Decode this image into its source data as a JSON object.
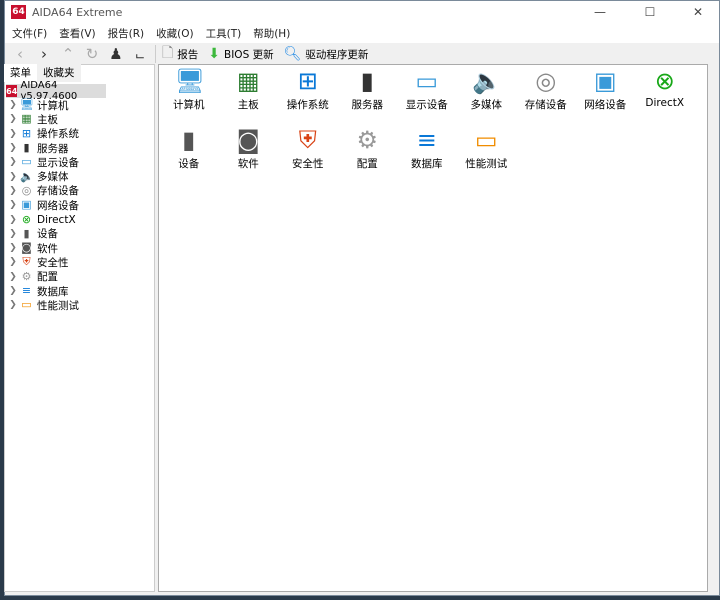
{
  "window": {
    "logo": "64",
    "title": "AIDA64 Extreme",
    "min": "—",
    "max": "☐",
    "close": "✕"
  },
  "menu": [
    "文件(F)",
    "查看(V)",
    "报告(R)",
    "收藏(O)",
    "工具(T)",
    "帮助(H)"
  ],
  "toolbar": {
    "report": "报告",
    "bios": "BIOS 更新",
    "driver": "驱动程序更新"
  },
  "tabs": [
    "菜单",
    "收藏夹"
  ],
  "tree_root": "AIDA64 v5.97.4600",
  "items": [
    {
      "label": "计算机",
      "icon": "computer-icon",
      "glyph": "🖥",
      "color": "#3a9ad9"
    },
    {
      "label": "主板",
      "icon": "motherboard-icon",
      "glyph": "▦",
      "color": "#2e7d32"
    },
    {
      "label": "操作系统",
      "icon": "windows-icon",
      "glyph": "⊞",
      "color": "#0a78d7"
    },
    {
      "label": "服务器",
      "icon": "server-icon",
      "glyph": "▮",
      "color": "#333"
    },
    {
      "label": "显示设备",
      "icon": "monitor-icon",
      "glyph": "▭",
      "color": "#3a9ad9"
    },
    {
      "label": "多媒体",
      "icon": "speaker-icon",
      "glyph": "🔈",
      "color": "#777"
    },
    {
      "label": "存储设备",
      "icon": "storage-icon",
      "glyph": "◎",
      "color": "#888"
    },
    {
      "label": "网络设备",
      "icon": "network-icon",
      "glyph": "▣",
      "color": "#3a9ad9"
    },
    {
      "label": "DirectX",
      "icon": "xbox-icon",
      "glyph": "⊗",
      "color": "#18a818"
    },
    {
      "label": "设备",
      "icon": "device-icon",
      "glyph": "▮",
      "color": "#555"
    },
    {
      "label": "软件",
      "icon": "software-icon",
      "glyph": "◙",
      "color": "#555"
    },
    {
      "label": "安全性",
      "icon": "shield-icon",
      "glyph": "⛨",
      "color": "#d84315"
    },
    {
      "label": "配置",
      "icon": "config-icon",
      "glyph": "⚙",
      "color": "#999"
    },
    {
      "label": "数据库",
      "icon": "database-icon",
      "glyph": "≡",
      "color": "#0a78d7"
    },
    {
      "label": "性能测试",
      "icon": "benchmark-icon",
      "glyph": "▭",
      "color": "#f08c00"
    }
  ]
}
